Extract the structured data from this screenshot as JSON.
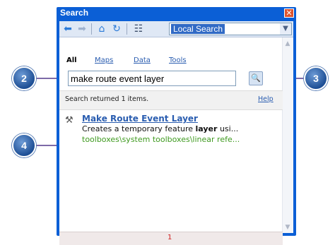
{
  "window": {
    "title": "Search",
    "close_glyph": "✕"
  },
  "toolbar": {
    "icons": [
      "back-arrow-icon",
      "forward-arrow-icon",
      "home-icon",
      "refresh-icon",
      "options-icon"
    ],
    "dropdown_value": "Local Search"
  },
  "tabs": [
    {
      "label": "All",
      "active": true
    },
    {
      "label": "Maps",
      "active": false
    },
    {
      "label": "Data",
      "active": false
    },
    {
      "label": "Tools",
      "active": false
    }
  ],
  "search": {
    "value": "make route event layer"
  },
  "status": {
    "text": "Search returned 1 items.",
    "help": "Help"
  },
  "result": {
    "title": "Make Route Event Layer",
    "desc_before": "Creates a temporary feature ",
    "desc_bold": "layer",
    "desc_after": " usi...",
    "path": "toolboxes\\system toolboxes\\linear refe..."
  },
  "pagination": {
    "page": "1"
  },
  "callouts": {
    "c2": "2",
    "c3": "3",
    "c4": "4"
  },
  "colors": {
    "title_bar": "#0b5fd6",
    "link": "#2a5db0",
    "path": "#3f9a20",
    "callout": "#1e4f95"
  }
}
